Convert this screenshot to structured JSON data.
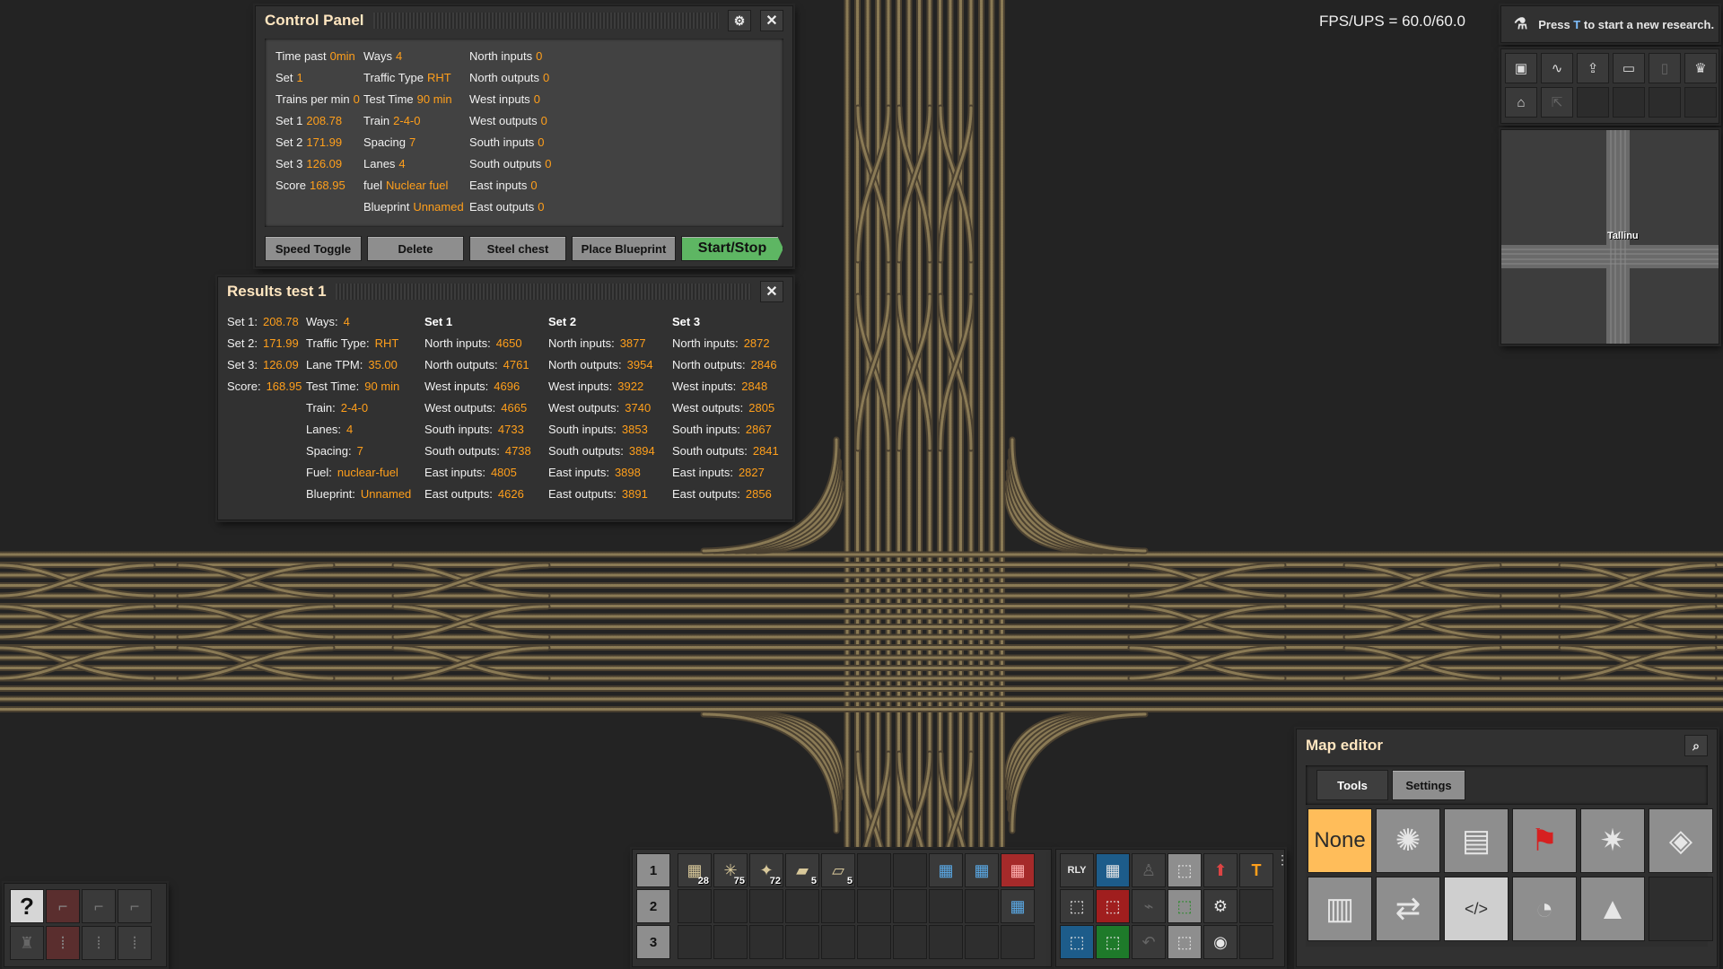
{
  "fps": "FPS/UPS = 60.0/60.0",
  "research": {
    "text_before": "Press ",
    "key": "T",
    "text_after": " to start a new research."
  },
  "minimap": {
    "label": "Tallinu"
  },
  "control_panel": {
    "title": "Control Panel",
    "col1": [
      {
        "label": "Time past",
        "value": "0min"
      },
      {
        "label": "Set",
        "value": "1"
      },
      {
        "label": "Trains per min",
        "value": "0"
      },
      {
        "label": "Set 1",
        "value": "208.78"
      },
      {
        "label": "Set 2",
        "value": "171.99"
      },
      {
        "label": "Set 3",
        "value": "126.09"
      },
      {
        "label": "Score",
        "value": "168.95"
      }
    ],
    "col2": [
      {
        "label": "Ways",
        "value": "4"
      },
      {
        "label": "Traffic Type",
        "value": "RHT"
      },
      {
        "label": "Test Time",
        "value": "90 min"
      },
      {
        "label": "Train",
        "value": "2-4-0"
      },
      {
        "label": "Spacing",
        "value": "7"
      },
      {
        "label": "Lanes",
        "value": "4"
      },
      {
        "label": "fuel",
        "value": "Nuclear fuel"
      },
      {
        "label": "Blueprint",
        "value": "Unnamed"
      }
    ],
    "col3": [
      {
        "label": "North inputs",
        "value": "0"
      },
      {
        "label": "North outputs",
        "value": "0"
      },
      {
        "label": "West inputs",
        "value": "0"
      },
      {
        "label": "West outputs",
        "value": "0"
      },
      {
        "label": "South inputs",
        "value": "0"
      },
      {
        "label": "South outputs",
        "value": "0"
      },
      {
        "label": "East inputs",
        "value": "0"
      },
      {
        "label": "East outputs",
        "value": "0"
      }
    ],
    "buttons": {
      "speed_toggle": "Speed Toggle",
      "delete": "Delete",
      "steel_chest": "Steel chest",
      "place_blueprint": "Place Blueprint",
      "start_stop": "Start/Stop"
    }
  },
  "results": {
    "title": "Results test 1",
    "summary_left": [
      {
        "label": "Set 1:",
        "value": "208.78"
      },
      {
        "label": "Set 2:",
        "value": "171.99"
      },
      {
        "label": "Set 3:",
        "value": "126.09"
      },
      {
        "label": "Score:",
        "value": "168.95"
      }
    ],
    "summary_right": [
      {
        "label": "Ways:",
        "value": "4"
      },
      {
        "label": "Traffic Type:",
        "value": "RHT"
      },
      {
        "label": "Lane TPM:",
        "value": "35.00"
      },
      {
        "label": "Test Time:",
        "value": "90 min"
      },
      {
        "label": "Train:",
        "value": "2-4-0"
      },
      {
        "label": "Lanes:",
        "value": "4"
      },
      {
        "label": "Spacing:",
        "value": "7"
      },
      {
        "label": "Fuel:",
        "value": "nuclear-fuel"
      },
      {
        "label": "Blueprint:",
        "value": "Unnamed"
      }
    ],
    "sets": [
      {
        "name": "Set 1",
        "rows": [
          {
            "label": "North inputs:",
            "value": "4650"
          },
          {
            "label": "North outputs:",
            "value": "4761"
          },
          {
            "label": "West inputs:",
            "value": "4696"
          },
          {
            "label": "West outputs:",
            "value": "4665"
          },
          {
            "label": "South inputs:",
            "value": "4733"
          },
          {
            "label": "South outputs:",
            "value": "4738"
          },
          {
            "label": "East inputs:",
            "value": "4805"
          },
          {
            "label": "East outputs:",
            "value": "4626"
          }
        ]
      },
      {
        "name": "Set 2",
        "rows": [
          {
            "label": "North inputs:",
            "value": "3877"
          },
          {
            "label": "North outputs:",
            "value": "3954"
          },
          {
            "label": "West inputs:",
            "value": "3922"
          },
          {
            "label": "West outputs:",
            "value": "3740"
          },
          {
            "label": "South inputs:",
            "value": "3853"
          },
          {
            "label": "South outputs:",
            "value": "3894"
          },
          {
            "label": "East inputs:",
            "value": "3898"
          },
          {
            "label": "East outputs:",
            "value": "3891"
          }
        ]
      },
      {
        "name": "Set 3",
        "rows": [
          {
            "label": "North inputs:",
            "value": "2872"
          },
          {
            "label": "North outputs:",
            "value": "2846"
          },
          {
            "label": "West inputs:",
            "value": "2848"
          },
          {
            "label": "West outputs:",
            "value": "2805"
          },
          {
            "label": "South inputs:",
            "value": "2867"
          },
          {
            "label": "South outputs:",
            "value": "2841"
          },
          {
            "label": "East inputs:",
            "value": "2827"
          },
          {
            "label": "East outputs:",
            "value": "2856"
          }
        ]
      }
    ]
  },
  "toolbar_row_numbers": [
    "1",
    "2",
    "3"
  ],
  "quickbar_slots": [
    {
      "icon": "rail-icon",
      "glyph": "▦",
      "count": "28"
    },
    {
      "icon": "rail-signal-icon",
      "glyph": "✳",
      "count": "75"
    },
    {
      "icon": "chain-signal-icon",
      "glyph": "✦",
      "count": "72"
    },
    {
      "icon": "locomotive-icon",
      "glyph": "▰",
      "count": "5"
    },
    {
      "icon": "cargo-wagon-icon",
      "glyph": "▱",
      "count": "5"
    }
  ],
  "map_editor": {
    "title": "Map editor",
    "tabs": {
      "tools": "Tools",
      "settings": "Settings"
    },
    "selected_tool": "None",
    "tools": [
      {
        "icon": "tree-icon",
        "glyph": "✺"
      },
      {
        "icon": "entity-icon",
        "glyph": "▤"
      },
      {
        "icon": "flag-icon",
        "glyph": "⚑"
      },
      {
        "icon": "decoratives-icon",
        "glyph": "✷"
      },
      {
        "icon": "tiles-icon",
        "glyph": "◈"
      },
      {
        "icon": "resources-icon",
        "glyph": "▥"
      },
      {
        "icon": "clone-icon",
        "glyph": "⇄"
      },
      {
        "icon": "script-icon",
        "glyph": "</>"
      },
      {
        "icon": "time-icon",
        "glyph": "◔"
      },
      {
        "icon": "cliff-icon",
        "glyph": "▲"
      }
    ]
  },
  "colors": {
    "accent": "#ff9f1b",
    "panel": "#313131",
    "rail": "#8a7a55",
    "start_button": "#5eb663",
    "selected_tool": "#ffbd5a"
  }
}
